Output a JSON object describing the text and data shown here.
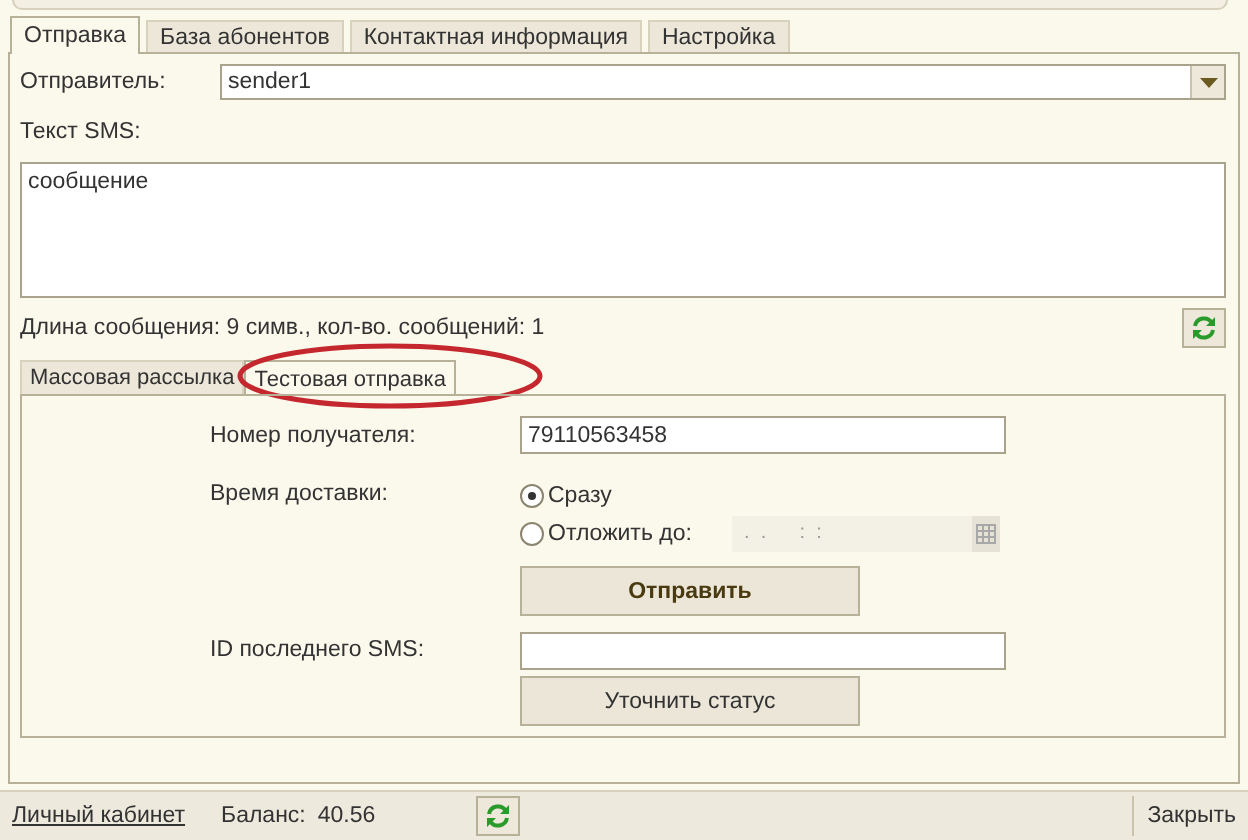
{
  "tabs": [
    {
      "label": "Отправка",
      "selected": true
    },
    {
      "label": "База абонентов",
      "selected": false
    },
    {
      "label": "Контактная информация",
      "selected": false
    },
    {
      "label": "Настройка",
      "selected": false
    }
  ],
  "sender": {
    "label": "Отправитель:",
    "value": "sender1"
  },
  "sms_text": {
    "label": "Текст SMS:",
    "value": "сообщение"
  },
  "length_info": "Длина сообщения: 9 симв., кол-во. сообщений: 1",
  "subtabs": [
    {
      "label": "Массовая рассылка",
      "selected": false,
      "highlighted": false
    },
    {
      "label": "Тестовая отправка",
      "selected": true,
      "highlighted": true
    }
  ],
  "recipient": {
    "label": "Номер получателя:",
    "value": "79110563458"
  },
  "delivery": {
    "label": "Время доставки:",
    "options": [
      {
        "label": "Сразу",
        "selected": true
      },
      {
        "label": "Отложить до:",
        "selected": false
      }
    ],
    "date_placeholder": ".  .      :  :"
  },
  "send_button": "Отправить",
  "last_id": {
    "label": "ID последнего SMS:"
  },
  "status_button": "Уточнить статус",
  "status_bar": {
    "link": "Личный кабинет",
    "balance_label": "Баланс:",
    "balance": "40.56",
    "close": "Закрыть"
  }
}
